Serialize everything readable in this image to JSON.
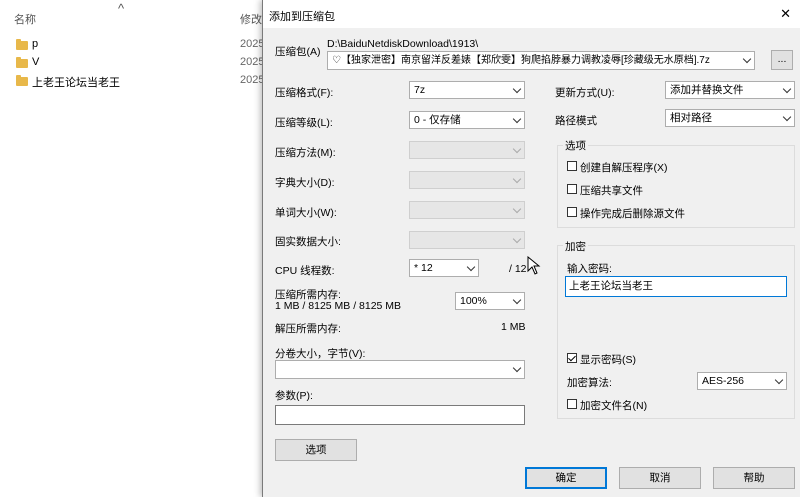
{
  "explorer": {
    "col_name": "名称",
    "col_modified": "修改",
    "sort_glyph": "^",
    "items": [
      {
        "name": "p",
        "date": "2025"
      },
      {
        "name": "V",
        "date": "2025"
      },
      {
        "name": "上老王论坛当老王",
        "date": "2025"
      }
    ]
  },
  "dialog": {
    "title": "添加到压缩包",
    "archive_label": "压缩包(A)",
    "archive_path": "D:\\BaiduNetdiskDownload\\1913\\",
    "archive_name": "♡【独家泄密】南京留洋反差婊【郑欣雯】狗爬掐脖暴力调教凌辱[珍藏级无水原档].7z",
    "browse_label": "...",
    "format_label": "压缩格式(F):",
    "format_value": "7z",
    "level_label": "压缩等级(L):",
    "level_value": "0 - 仅存储",
    "method_label": "压缩方法(M):",
    "dict_label": "字典大小(D):",
    "word_label": "单词大小(W):",
    "solid_label": "固实数据大小:",
    "threads_label": "CPU 线程数:",
    "threads_value": "* 12",
    "threads_total": "/ 12",
    "mem_compress_label": "压缩所需内存:",
    "mem_compress_value": "1 MB / 8125 MB / 8125 MB",
    "mem_percent": "100%",
    "mem_decompress_label": "解压所需内存:",
    "mem_decompress_value": "1 MB",
    "split_label": "分卷大小，字节(V):",
    "split_value": "",
    "params_label": "参数(P):",
    "params_value": "",
    "options_button": "选项",
    "update_label": "更新方式(U):",
    "update_value": "添加并替换文件",
    "path_label": "路径模式",
    "path_value": "相对路径",
    "options_group": "选项",
    "opt_sfx": "创建自解压程序(X)",
    "opt_shared": "压缩共享文件",
    "opt_delete": "操作完成后删除源文件",
    "encrypt_group": "加密",
    "password_label": "输入密码:",
    "password_value": "上老王论坛当老王",
    "show_password": "显示密码(S)",
    "encrypt_method_label": "加密算法:",
    "encrypt_method_value": "AES-256",
    "encrypt_names": "加密文件名(N)",
    "ok_button": "确定",
    "cancel_button": "取消",
    "help_button": "帮助",
    "close_glyph": "✕"
  }
}
